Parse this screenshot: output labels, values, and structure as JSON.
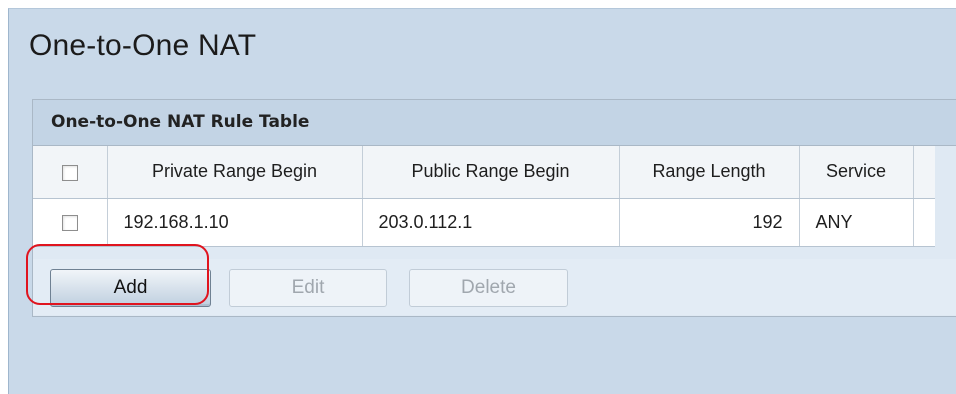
{
  "page": {
    "title": "One-to-One NAT"
  },
  "rule_table": {
    "title": "One-to-One NAT Rule Table",
    "columns": [
      "",
      "Private Range Begin",
      "Public Range Begin",
      "Range Length",
      "Service",
      ""
    ],
    "rows": [
      {
        "checked": false,
        "private_range_begin": "192.168.1.10",
        "public_range_begin": "203.0.112.1",
        "range_length": "192",
        "service": "ANY"
      }
    ]
  },
  "buttons": {
    "add": "Add",
    "edit": "Edit",
    "delete": "Delete"
  },
  "colors": {
    "background": "#c9d9e9",
    "highlight": "#e0141e"
  }
}
